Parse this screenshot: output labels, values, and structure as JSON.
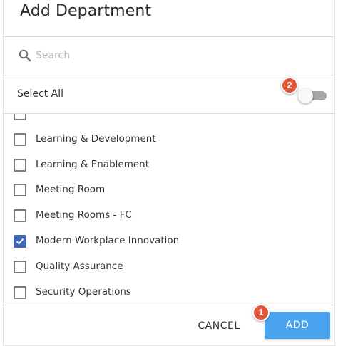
{
  "dialog": {
    "title": "Add Department"
  },
  "search": {
    "placeholder": "Search",
    "icon": "search-icon"
  },
  "select_all": {
    "label": "Select All",
    "toggle_on": false,
    "badge": "2"
  },
  "departments": [
    {
      "label": "",
      "checked": false,
      "partial": true
    },
    {
      "label": "Learning & Development",
      "checked": false
    },
    {
      "label": "Learning & Enablement",
      "checked": false
    },
    {
      "label": "Meeting Room",
      "checked": false
    },
    {
      "label": "Meeting Rooms - FC",
      "checked": false
    },
    {
      "label": "Modern Workplace Innovation",
      "checked": true
    },
    {
      "label": "Quality Assurance",
      "checked": false
    },
    {
      "label": "Security Operations",
      "checked": false
    },
    {
      "label": "",
      "checked": false,
      "partial": true
    }
  ],
  "footer": {
    "cancel_label": "CANCEL",
    "add_label": "ADD",
    "add_badge": "1"
  },
  "colors": {
    "accent": "#4aa3ee",
    "checkbox_checked": "#3f66b0",
    "badge": "#e2563a"
  }
}
